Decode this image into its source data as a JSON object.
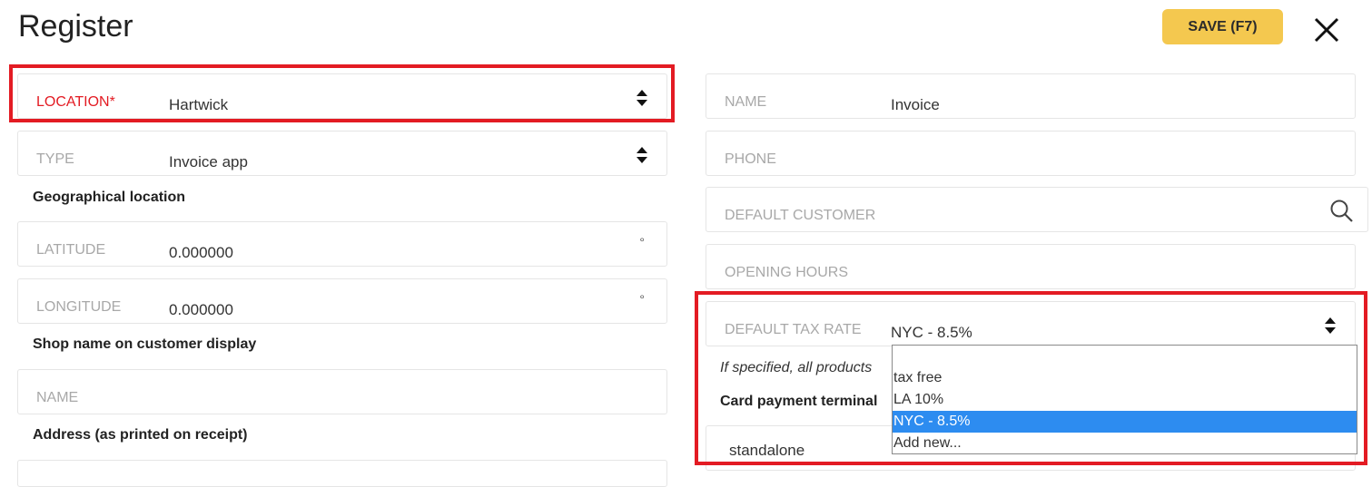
{
  "header": {
    "title": "Register",
    "save_label": "SAVE (F7)",
    "close_icon": "close-icon"
  },
  "left": {
    "location": {
      "label": "LOCATION*",
      "value": "Hartwick"
    },
    "type": {
      "label": "TYPE",
      "value": "Invoice app"
    },
    "geo_section": "Geographical location",
    "latitude": {
      "label": "LATITUDE",
      "value": "0.000000",
      "unit": "°"
    },
    "longitude": {
      "label": "LONGITUDE",
      "value": "0.000000",
      "unit": "°"
    },
    "shop_section": "Shop name on customer display",
    "shop_name": {
      "placeholder": "NAME"
    },
    "address_section": "Address (as printed on receipt)"
  },
  "right": {
    "name": {
      "label": "NAME",
      "value": "Invoice"
    },
    "phone": {
      "label": "PHONE"
    },
    "default_customer": {
      "label": "DEFAULT CUSTOMER"
    },
    "opening_hours": {
      "label": "OPENING HOURS"
    },
    "default_tax_rate": {
      "label": "DEFAULT TAX RATE",
      "value": "NYC - 8.5%"
    },
    "hint": "If specified, all products",
    "card_terminal_section": "Card payment terminal",
    "card_terminal_value": "standalone"
  },
  "tax_dropdown": {
    "options": [
      "",
      "tax free",
      "LA 10%",
      "NYC - 8.5%",
      "Add new..."
    ],
    "selected_index": 3
  },
  "colors": {
    "required_label": "#e31b23",
    "highlight_border": "#e31b23",
    "save_button": "#f4c84f",
    "selected_option": "#2d8cf0"
  }
}
